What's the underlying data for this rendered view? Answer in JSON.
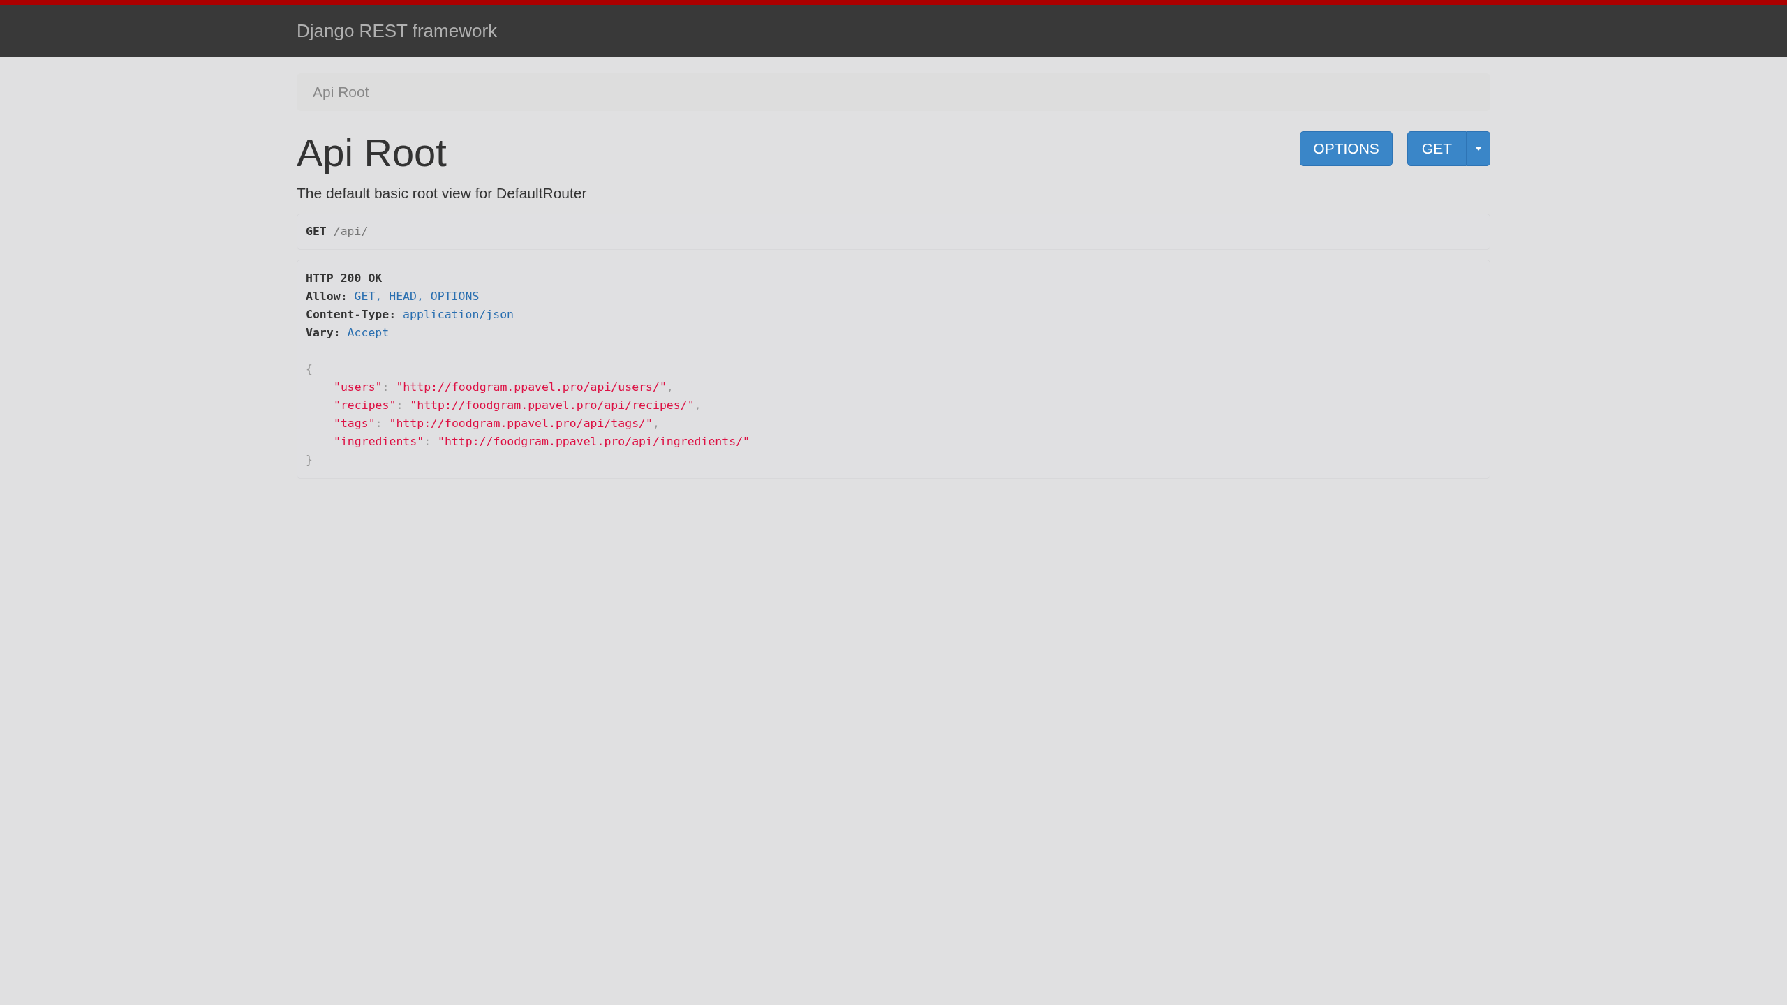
{
  "navbar": {
    "brand": "Django REST framework"
  },
  "breadcrumb": [
    {
      "label": "Api Root",
      "selected": true
    }
  ],
  "title": "Api Root",
  "buttons": [
    {
      "label": "OPTIONS",
      "kind": "plain"
    },
    {
      "label": "GET",
      "kind": "split"
    }
  ],
  "description": "The default basic root view for DefaultRouter",
  "request": {
    "method": "GET",
    "path": "/api/"
  },
  "response": {
    "status": "HTTP 200 OK",
    "headers": [
      {
        "name": "Allow:",
        "value": "GET, HEAD, OPTIONS"
      },
      {
        "name": "Content-Type:",
        "value": "application/json"
      },
      {
        "name": "Vary:",
        "value": "Accept"
      }
    ],
    "open": "{",
    "entries": [
      {
        "key": "\"users\"",
        "sep": ": ",
        "value": "\"http://foodgram.ppavel.pro/api/users/\"",
        "comma": ","
      },
      {
        "key": "\"recipes\"",
        "sep": ": ",
        "value": "\"http://foodgram.ppavel.pro/api/recipes/\"",
        "comma": ","
      },
      {
        "key": "\"tags\"",
        "sep": ": ",
        "value": "\"http://foodgram.ppavel.pro/api/tags/\"",
        "comma": ","
      },
      {
        "key": "\"ingredients\"",
        "sep": ": ",
        "value": "\"http://foodgram.ppavel.pro/api/ingredients/\""
      }
    ],
    "close": "}"
  }
}
